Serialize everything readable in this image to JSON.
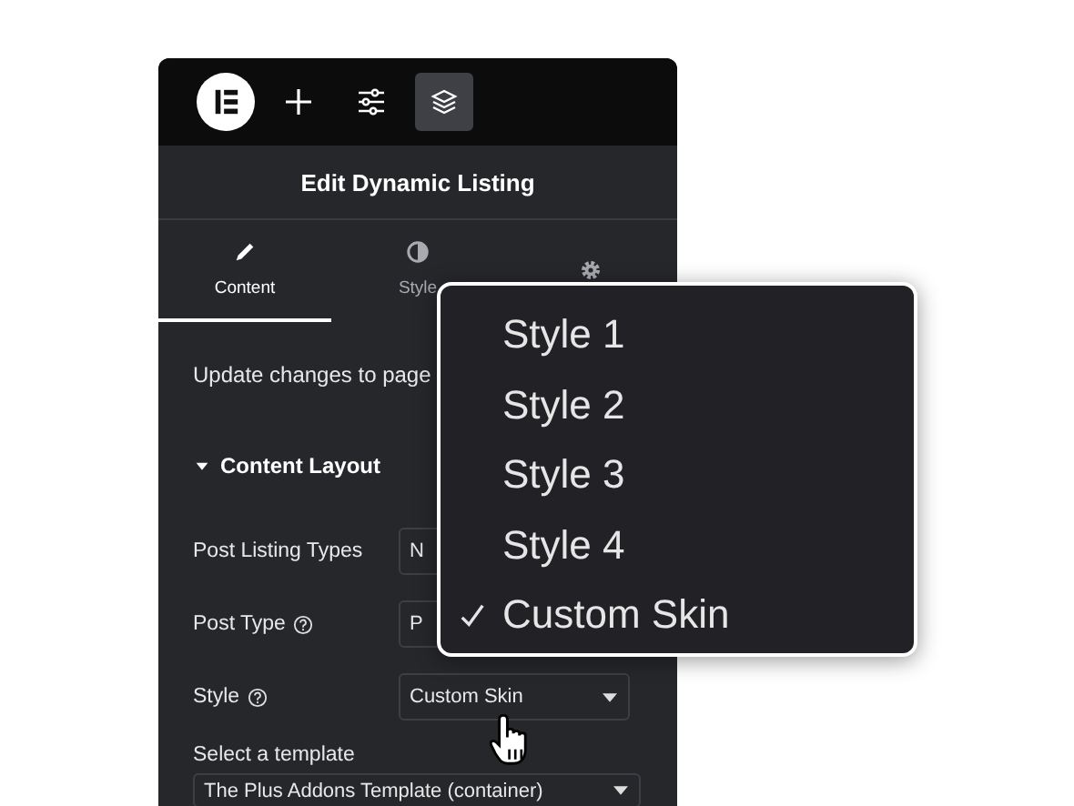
{
  "toolbar": {
    "buttons": [
      {
        "kind": "logo",
        "selected": false
      },
      {
        "kind": "add",
        "selected": false
      },
      {
        "kind": "sliders",
        "selected": false
      },
      {
        "kind": "layers",
        "selected": true
      }
    ]
  },
  "panel": {
    "title": "Edit Dynamic Listing"
  },
  "tabs": [
    {
      "kind": "pencil",
      "label": "Content",
      "selected": true
    },
    {
      "kind": "contrast",
      "label": "Style",
      "selected": false
    },
    {
      "kind": "gear",
      "selected": false
    }
  ],
  "notice": "Update changes to page",
  "section": {
    "title": "Content Layout",
    "expanded": true
  },
  "controls": [
    {
      "label": "Post Listing Types",
      "help": false,
      "value": "N"
    },
    {
      "label": "Post Type",
      "help": true,
      "value": "P"
    },
    {
      "label": "Style",
      "help": true,
      "value": "Custom Skin"
    }
  ],
  "template": {
    "label": "Select a template",
    "value": "The Plus Addons Template (container)"
  },
  "menu": {
    "items": [
      {
        "label": "Style 1",
        "selected": false
      },
      {
        "label": "Style 2",
        "selected": false
      },
      {
        "label": "Style 3",
        "selected": false
      },
      {
        "label": "Style 4",
        "selected": false
      },
      {
        "label": "Custom Skin",
        "selected": true
      }
    ]
  }
}
